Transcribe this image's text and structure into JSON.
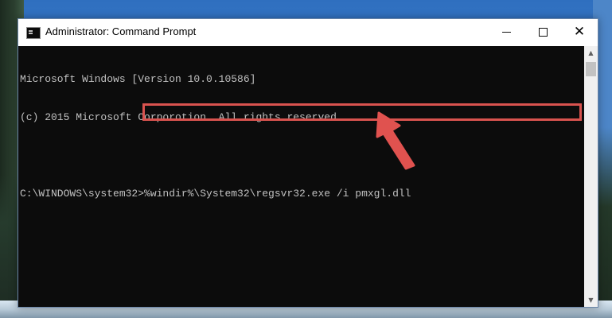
{
  "window": {
    "title": "Administrator: Command Prompt",
    "buttons": {
      "minimize": "minimize",
      "maximize": "maximize",
      "close": "close"
    }
  },
  "console": {
    "lines": [
      "Microsoft Windows [Version 10.0.10586]",
      "(c) 2015 Microsoft Corporotion. All rights reserved.",
      "",
      "C:\\WINDOWS\\system32>%windir%\\System32\\regsvr32.exe /i pmxgl.dll"
    ],
    "colors": {
      "background": "#0c0c0c",
      "text": "#c0c0c0",
      "highlight": "#d9534f",
      "arrow": "#e0524f"
    }
  },
  "icons": {
    "app": "command-prompt-icon",
    "arrow": "red-arrow-icon"
  }
}
